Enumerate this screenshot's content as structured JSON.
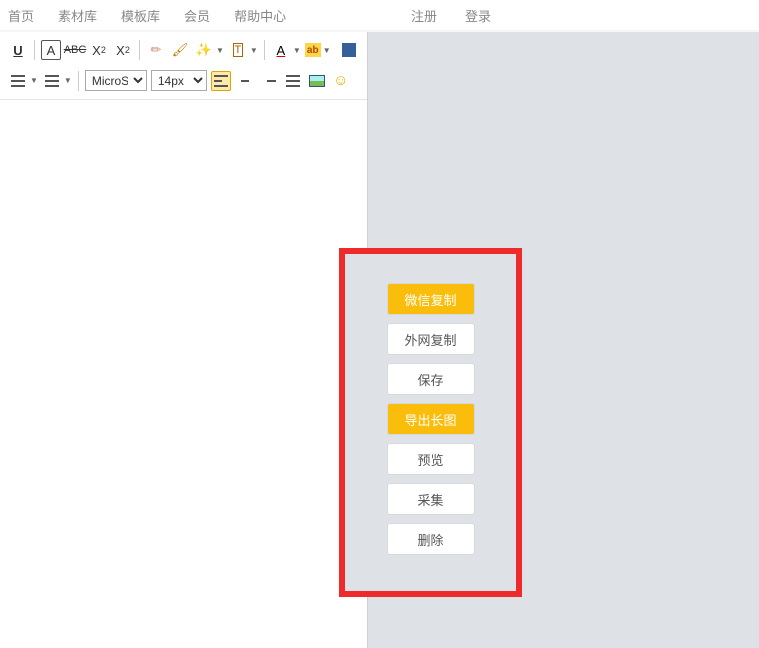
{
  "nav": {
    "left": [
      "首页",
      "素材库",
      "模板库",
      "会员",
      "帮助中心"
    ],
    "right": [
      "注册",
      "登录"
    ]
  },
  "toolbar": {
    "row1": {
      "underline": "U",
      "boxA": "A",
      "strike": "ABC",
      "sup_label": "X",
      "sub_label": "X",
      "fontA": "A",
      "highlight": "ab",
      "date": "T"
    },
    "font_select": "MicroSoft",
    "size_select": "14px"
  },
  "actions": [
    {
      "key": "wechat_copy",
      "label": "微信复制",
      "primary": true
    },
    {
      "key": "external_copy",
      "label": "外网复制",
      "primary": false
    },
    {
      "key": "save",
      "label": "保存",
      "primary": false
    },
    {
      "key": "export_long",
      "label": "导出长图",
      "primary": true
    },
    {
      "key": "preview",
      "label": "预览",
      "primary": false
    },
    {
      "key": "collect",
      "label": "采集",
      "primary": false
    },
    {
      "key": "delete",
      "label": "删除",
      "primary": false
    }
  ]
}
